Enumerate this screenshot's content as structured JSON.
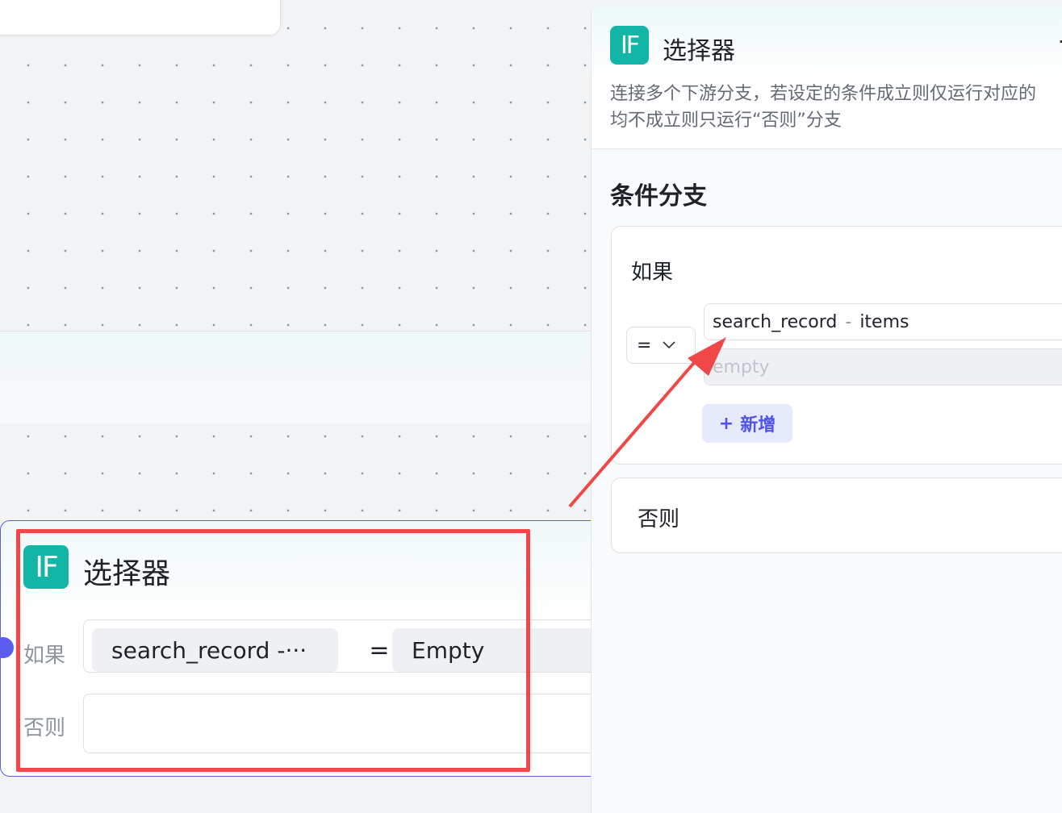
{
  "node": {
    "badge": "IF",
    "title": "选择器",
    "if_label": "如果",
    "else_label": "否则",
    "condition": {
      "variable": "search_record  -···",
      "operator": "=",
      "value": "Empty"
    }
  },
  "panel": {
    "badge": "IF",
    "title": "选择器",
    "close_glyph": "·",
    "description_line1": "连接多个下游分支，若设定的条件成立则仅运行对应的",
    "description_line2": "均不成立则只运行“否则”分支",
    "section_title": "条件分支",
    "if_card": {
      "label": "如果",
      "operator": "=",
      "variable_name": "search_record",
      "variable_sep": "-",
      "variable_field": "items",
      "value_placeholder": "empty",
      "add_button": "新增",
      "add_icon": "+"
    },
    "else_card": {
      "label": "否则"
    }
  },
  "colors": {
    "accent": "#5b5cf0",
    "badge": "#13b5a6",
    "annotation": "#f04848"
  }
}
